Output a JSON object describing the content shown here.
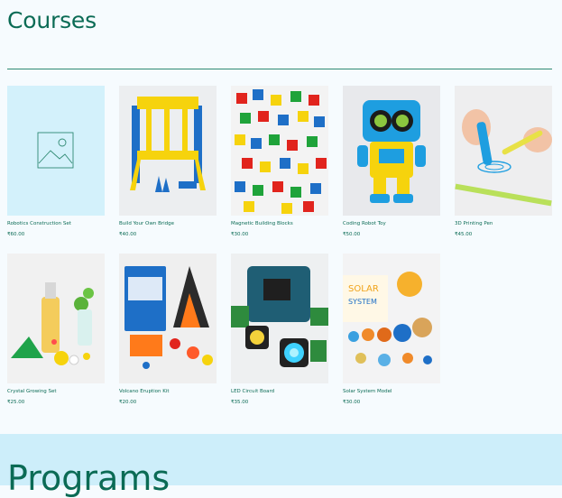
{
  "sections": {
    "courses_title": "Courses",
    "programs_title": "Programs"
  },
  "courses": [
    {
      "name": "Robotics Construction Set",
      "price": "₹60.00",
      "image": "placeholder-image-icon"
    },
    {
      "name": "Build Your Own Bridge",
      "price": "₹40.00",
      "image": "yellow-blue-bridge-toy"
    },
    {
      "name": "Magnetic Building Blocks",
      "price": "₹30.00",
      "image": "colorful-blocks"
    },
    {
      "name": "Coding Robot Toy",
      "price": "₹50.00",
      "image": "yellow-blue-robot"
    },
    {
      "name": "3D Printing Pen",
      "price": "₹45.00",
      "image": "3d-pen"
    },
    {
      "name": "Crystal Growing Set",
      "price": "₹25.00",
      "image": "crystal-kit"
    },
    {
      "name": "Volcano Eruption Kit",
      "price": "₹20.00",
      "image": "volcano-kit"
    },
    {
      "name": "LED Circuit Board",
      "price": "₹35.00",
      "image": "led-circuit"
    },
    {
      "name": "Solar System Model",
      "price": "₹30.00",
      "image": "solar-system"
    }
  ],
  "colors": {
    "accent": "#0b6b55",
    "band": "#cdeefa",
    "placeholder_bg": "#d3f1fb"
  }
}
